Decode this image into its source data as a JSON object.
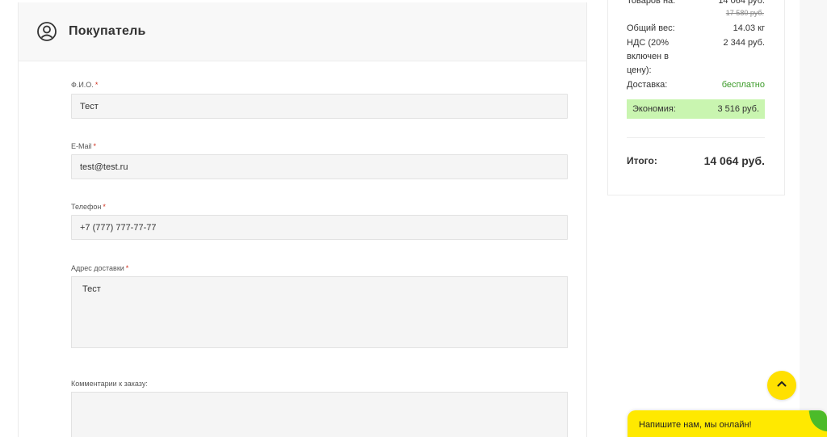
{
  "buyer": {
    "title": "Покупатель",
    "fields": {
      "fio": {
        "label": "Ф.И.О.",
        "required": "*",
        "value": "Тест"
      },
      "email": {
        "label": "E-Mail",
        "required": "*",
        "value": "test@test.ru"
      },
      "phone": {
        "label": "Телефон",
        "required": "*",
        "value": "+7 (777) 777-77-77"
      },
      "address": {
        "label": "Адрес доставки",
        "required": "*",
        "value": "Тест"
      },
      "comment": {
        "label": "Комментарии к заказу:",
        "value": ""
      }
    }
  },
  "summary": {
    "goods_label": "Товаров на:",
    "goods_value": "14 064 руб.",
    "goods_old": "17 580 руб.",
    "weight_label": "Общий вес:",
    "weight_value": "14.03 кг",
    "vat_label": "НДС (20% включен в цену):",
    "vat_value": "2 344 руб.",
    "delivery_label": "Доставка:",
    "delivery_value": "бесплатно",
    "economy_label": "Экономия:",
    "economy_value": "3 516 руб.",
    "total_label": "Итого:",
    "total_value": "14 064 руб."
  },
  "chat": {
    "label": "Напишите нам, мы онлайн!"
  },
  "icons": {
    "buyer": "user-circle-icon",
    "scroll_top": "chevron-up-icon"
  },
  "colors": {
    "accent_yellow": "#ffe000",
    "economy_bg": "#c9f5b0",
    "green_text": "#3a9a27",
    "required": "#d0301e"
  }
}
